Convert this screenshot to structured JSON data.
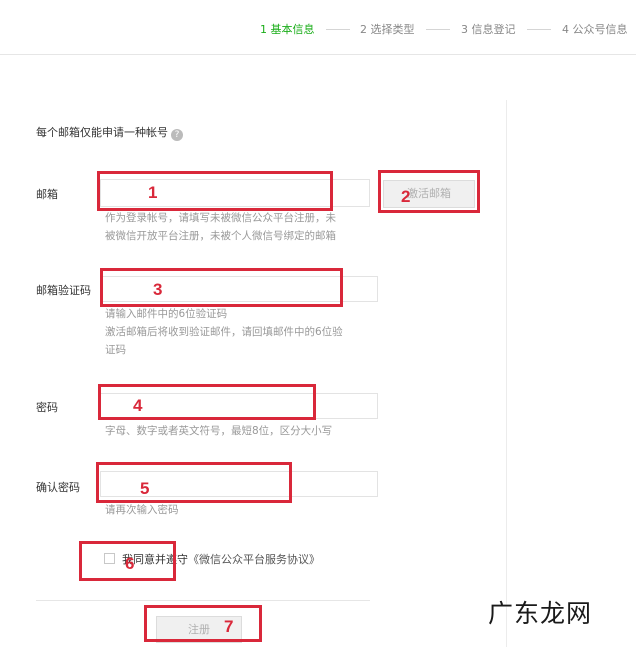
{
  "steps": [
    {
      "label": "1 基本信息",
      "active": true
    },
    {
      "label": "2 选择类型",
      "active": false
    },
    {
      "label": "3 信息登记",
      "active": false
    },
    {
      "label": "4 公众号信息",
      "active": false
    }
  ],
  "colors": {
    "active_step": "#1aad19",
    "annotation": "#d9283a",
    "help_text": "#999999"
  },
  "form": {
    "intro": "每个邮箱仅能申请一种帐号",
    "intro_icon": "question-icon",
    "email": {
      "label": "邮箱",
      "help_1": "作为登录帐号，请填写未被微信公众平台注册，未",
      "help_2": "被微信开放平台注册，未被个人微信号绑定的邮箱",
      "activate_button": "激活邮箱"
    },
    "code": {
      "label": "邮箱验证码",
      "hint": "请输入邮件中的6位验证码",
      "help_1": "激活邮箱后将收到验证邮件，请回填邮件中的6位验",
      "help_2": "证码"
    },
    "password": {
      "label": "密码",
      "help": "字母、数字或者英文符号，最短8位，区分大小写"
    },
    "confirm": {
      "label": "确认密码",
      "help": "请再次输入密码"
    },
    "agree": {
      "prefix": "我同意并遵守",
      "link": "《微信公众平台服务协议》"
    },
    "submit": "注册"
  },
  "annotations": [
    "1",
    "2",
    "3",
    "4",
    "5",
    "6",
    "7"
  ],
  "watermark": "广东龙网"
}
